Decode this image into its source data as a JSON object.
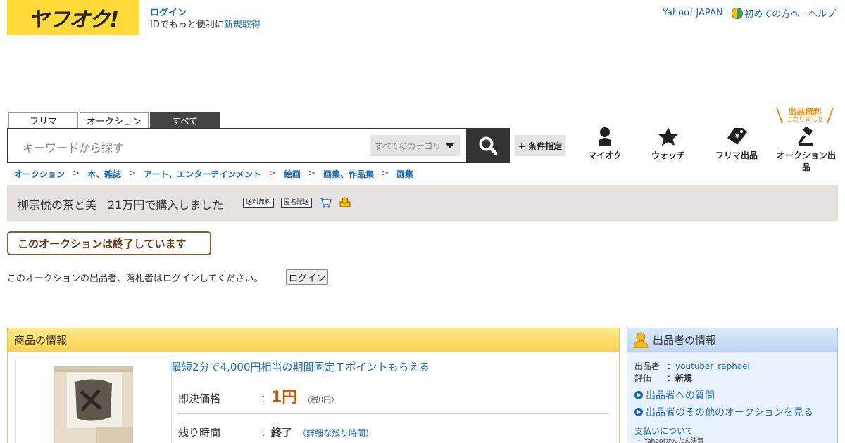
{
  "header": {
    "logo_text": "ヤフオク!",
    "login_label": "ログイン",
    "id_note": "IDでもっと便利に",
    "register_label": "新規取得",
    "yahoo_japan": "Yahoo! JAPAN",
    "beginner": "初めての方へ",
    "help": "ヘルプ",
    "sep": "-"
  },
  "search": {
    "tabs": [
      "フリマ",
      "オークション",
      "すべて"
    ],
    "active_tab": "すべて",
    "placeholder": "キーワードから探す",
    "category": "すべてのカテゴリ",
    "condition_button": "+ 条件指定"
  },
  "nav": {
    "my_auction": "マイオク",
    "watch": "ウォッチ",
    "fleamarket_listing": "フリマ出品",
    "auction_listing": "オークション出品",
    "free_badge_big": "出品無料",
    "free_badge_small": "になりました"
  },
  "breadcrumb": [
    "オークション",
    "本、雑誌",
    "アート、エンターテインメント",
    "絵画",
    "画集、作品集",
    "画集"
  ],
  "breadcrumb_sep": ">",
  "item": {
    "title": "柳宗悦の茶と美　21万円で購入しました",
    "badge_shipping": "送料無料",
    "badge_anonymous": "匿名配送"
  },
  "ended_notice": "このオークションは終了しています",
  "login_note": "このオークションの出品者、落札者はログインしてください。",
  "login_button": "ログイン",
  "product_panel": {
    "heading": "商品の情報",
    "promo": "最短2分で4,000円相当の期間固定Ｔポイントもらえる",
    "price_label": "即決価格",
    "colon": "：",
    "price": "1円",
    "tax": "（税0円）",
    "remaining_label": "残り時間",
    "remaining_value": "終了",
    "remaining_detail": "（詳細な残り時間）"
  },
  "seller_panel": {
    "heading": "出品者の情報",
    "seller_key": "出品者",
    "seller_name": "youtuber_raphael",
    "rating_key": "評価",
    "rating_value": "新規",
    "colon": "：",
    "question_link": "出品者への質問",
    "other_auctions_link": "出品者のその他のオークションを見る",
    "payment_heading": "支払いについて",
    "payment_sub": "・ Yahoo!かんたん決済"
  },
  "colors": {
    "logo_bg": "#ffda38",
    "link": "#1a6bb5",
    "price": "#c05a00",
    "ended_border": "#8a5a2b"
  }
}
